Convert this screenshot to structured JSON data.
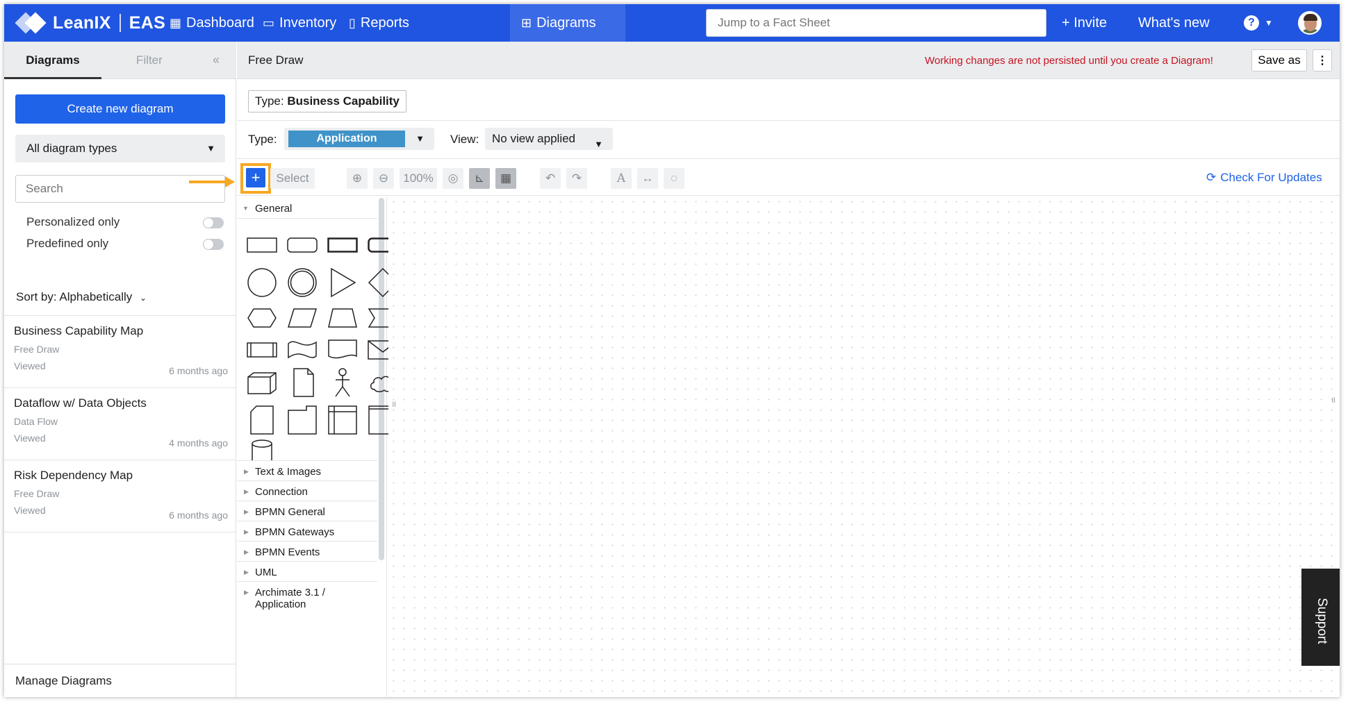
{
  "nav": {
    "brand": "LeanIX",
    "product": "EAS",
    "items": [
      {
        "label": "Dashboard",
        "icon": "grid-icon"
      },
      {
        "label": "Inventory",
        "icon": "inventory-icon"
      },
      {
        "label": "Reports",
        "icon": "bar-chart-icon"
      },
      {
        "label": "Diagrams",
        "icon": "sitemap-icon"
      }
    ],
    "search_placeholder": "Jump to a Fact Sheet",
    "invite": "+ Invite",
    "whats_new": "What's new",
    "colors": {
      "brand": "#1f55e0",
      "active": "#3b6ae6"
    }
  },
  "sidebar": {
    "tabs": [
      "Diagrams",
      "Filter"
    ],
    "collapse": "«",
    "create_button": "Create new diagram",
    "types_dropdown": "All diagram types",
    "search_placeholder": "Search",
    "toggles": [
      {
        "label": "Personalized only",
        "on": false
      },
      {
        "label": "Predefined only",
        "on": false
      }
    ],
    "sort_label": "Sort by: Alphabetically",
    "items": [
      {
        "title": "Business Capability Map",
        "type": "Free Draw",
        "viewed": "Viewed",
        "ago": "6 months ago"
      },
      {
        "title": "Dataflow w/ Data Objects",
        "type": "Data Flow",
        "viewed": "Viewed",
        "ago": "4 months ago"
      },
      {
        "title": "Risk Dependency Map",
        "type": "Free Draw",
        "viewed": "Viewed",
        "ago": "6 months ago"
      }
    ],
    "manage": "Manage Diagrams"
  },
  "editor": {
    "title": "Free Draw",
    "warning": "Working changes are not persisted until you create a Diagram!",
    "save_as": "Save as",
    "more": "⋮",
    "type_chip_prefix": "Type:",
    "type_chip_value": "Business Capability",
    "type_label": "Type:",
    "type_value": "Application",
    "view_label": "View:",
    "view_value": "No view applied",
    "toolbar": {
      "add": "+",
      "select": "Select",
      "zoom": "100%",
      "check_updates": "Check For Updates"
    },
    "palette": {
      "open_category": "General",
      "categories": [
        "Text & Images",
        "Connection",
        "BPMN General",
        "BPMN Gateways",
        "BPMN Events",
        "UML",
        "Archimate 3.1 / Application"
      ]
    },
    "support": "Support",
    "colors": {
      "warning": "#c6121f",
      "highlight": "#f7a823",
      "type_pill": "#3f93c9"
    }
  }
}
